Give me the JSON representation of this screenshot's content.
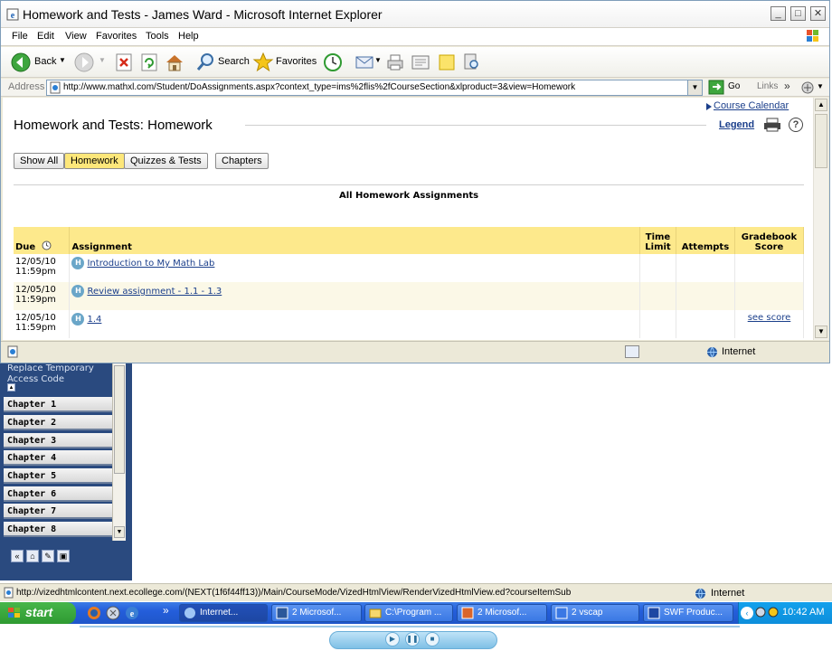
{
  "window": {
    "title": "Homework and Tests - James Ward - Microsoft Internet Explorer",
    "controls": {
      "minimize": "_",
      "maximize": "□",
      "close": "✕"
    }
  },
  "menu": [
    "File",
    "Edit",
    "View",
    "Favorites",
    "Tools",
    "Help"
  ],
  "toolbar": {
    "back_label": "Back",
    "search_label": "Search",
    "favorites_label": "Favorites"
  },
  "address": {
    "label": "Address",
    "url": "http://www.mathxl.com/Student/DoAssignments.aspx?context_type=ims%2flis%2fCourseSection&xlproduct=3&view=Homework",
    "go_label": "Go",
    "links_label": "Links",
    "links_chevron": "»"
  },
  "page": {
    "heading": "Homework and Tests: Homework",
    "course_calendar": "Course Calendar",
    "legend": "Legend",
    "help_glyph": "?",
    "filters": [
      {
        "label": "Show All",
        "active": false
      },
      {
        "label": "Homework",
        "active": true
      },
      {
        "label": "Quizzes & Tests",
        "active": false
      },
      {
        "label": "Chapters",
        "active": false
      }
    ],
    "table_caption": "All Homework Assignments",
    "columns": {
      "due": "Due",
      "assignment": "Assignment",
      "time_limit": "Time Limit",
      "attempts": "Attempts",
      "gradebook_score": "Gradebook Score"
    },
    "rows": [
      {
        "due_date": "12/05/10",
        "due_time": "11:59pm",
        "badge": "H",
        "title": "Introduction to My Math Lab",
        "time_limit": "",
        "attempts": "",
        "score": ""
      },
      {
        "due_date": "12/05/10",
        "due_time": "11:59pm",
        "badge": "H",
        "title": "Review assignment - 1.1 - 1.3",
        "time_limit": "",
        "attempts": "",
        "score": ""
      },
      {
        "due_date": "12/05/10",
        "due_time": "11:59pm",
        "badge": "H",
        "title": "1.4",
        "time_limit": "",
        "attempts": "",
        "score": "see score"
      }
    ]
  },
  "ie_status": {
    "zone": "Internet"
  },
  "course_nav": {
    "top_text": "Replace Temporary Access Code",
    "chapters": [
      "Chapter 1",
      "Chapter 2",
      "Chapter 3",
      "Chapter 4",
      "Chapter 5",
      "Chapter 6",
      "Chapter 7",
      "Chapter 8"
    ]
  },
  "main_status": {
    "url": "http://vizedhtmlcontent.next.ecollege.com/(NEXT(1f6f44ff13))/Main/CourseMode/VizedHtmlView/RenderVizedHtmlView.ed?courseItemSub",
    "zone": "Internet"
  },
  "taskbar": {
    "start": "start",
    "quicklaunch_chevron": "»",
    "tasks": [
      {
        "label": "Internet...",
        "active": true
      },
      {
        "label": "2 Microsof...",
        "active": false
      },
      {
        "label": "C:\\Program ...",
        "active": false
      },
      {
        "label": "2 Microsof...",
        "active": false
      },
      {
        "label": "2 vscap",
        "active": false
      },
      {
        "label": "SWF Produc...",
        "active": false
      }
    ],
    "clock": "10:42 AM"
  },
  "colors": {
    "table_header": "#fde98c",
    "active_filter": "#fde77a",
    "link": "#1b3f8b",
    "badge": "#6aa6c8",
    "nav_bg": "#2a4a7f",
    "taskbar": "#245edb",
    "start": "#2f9a31"
  }
}
